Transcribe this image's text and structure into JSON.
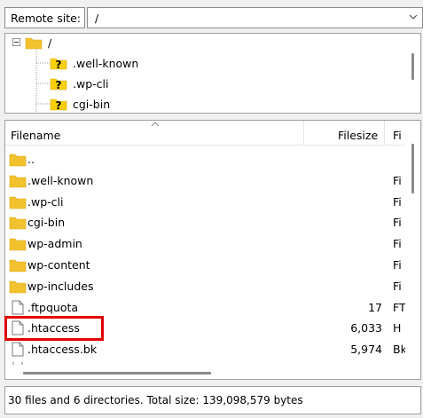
{
  "remote": {
    "label": "Remote site:",
    "path": "/"
  },
  "tree": {
    "root": "/",
    "children": [
      ".well-known",
      ".wp-cli",
      "cgi-bin"
    ]
  },
  "file_list": {
    "columns": {
      "filename": "Filename",
      "filesize": "Filesize",
      "filetype": "Fi"
    },
    "rows": [
      {
        "name": "..",
        "size": "",
        "type": "",
        "kind": "folder"
      },
      {
        "name": ".well-known",
        "size": "",
        "type": "Fi",
        "kind": "folder"
      },
      {
        "name": ".wp-cli",
        "size": "",
        "type": "Fi",
        "kind": "folder"
      },
      {
        "name": "cgi-bin",
        "size": "",
        "type": "Fi",
        "kind": "folder"
      },
      {
        "name": "wp-admin",
        "size": "",
        "type": "Fi",
        "kind": "folder"
      },
      {
        "name": "wp-content",
        "size": "",
        "type": "Fi",
        "kind": "folder"
      },
      {
        "name": "wp-includes",
        "size": "",
        "type": "Fi",
        "kind": "folder"
      },
      {
        "name": ".ftpquota",
        "size": "17",
        "type": "FT",
        "kind": "file"
      },
      {
        "name": ".htaccess",
        "size": "6,033",
        "type": "H",
        "kind": "file"
      },
      {
        "name": ".htaccess.bk",
        "size": "5,974",
        "type": "Bk",
        "kind": "file"
      }
    ]
  },
  "status": {
    "text": "30 files and 6 directories. Total size: 139,098,579 bytes"
  },
  "colors": {
    "folder": "#f2c22e",
    "question": "#f6d000",
    "highlight": "#e00000"
  }
}
